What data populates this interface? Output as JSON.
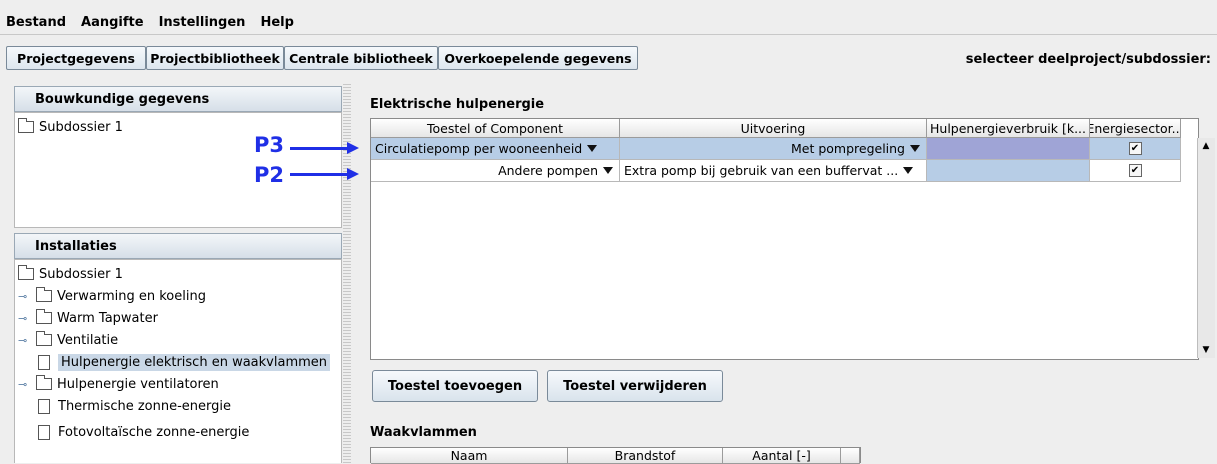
{
  "menu": [
    "Bestand",
    "Aangifte",
    "Instellingen",
    "Help"
  ],
  "tabs": [
    "Projectgegevens",
    "Projectbibliotheek",
    "Centrale bibliotheek",
    "Overkoepelende gegevens"
  ],
  "subproject_label": "selecteer deelproject/subdossier:",
  "left": {
    "bouw_title": "Bouwkundige gegevens",
    "bouw_tree": [
      "Subdossier 1"
    ],
    "inst_title": "Installaties",
    "inst_tree": {
      "root": "Subdossier 1",
      "items": [
        "Verwarming en koeling",
        "Warm Tapwater",
        "Ventilatie",
        "Hulpenergie elektrisch en waakvlammen",
        "Hulpenergie ventilatoren",
        "Thermische zonne-energie",
        "Fotovoltaïsche zonne-energie"
      ]
    }
  },
  "annotations": {
    "p3": "P3",
    "p2": "P2"
  },
  "section1": {
    "title": "Elektrische hulpenergie",
    "columns": [
      "Toestel of Component",
      "Uitvoering",
      "Hulpenergieverbruik [k...",
      "Energiesector..."
    ],
    "rows": [
      {
        "component": "Circulatiepomp per wooneenheid",
        "uitvoering": "Met pompregeling",
        "verbruik": "",
        "energiesector": true
      },
      {
        "component": "Andere pompen",
        "uitvoering": "Extra pomp bij gebruik van een buffervat ...",
        "verbruik": "",
        "energiesector": true
      }
    ]
  },
  "buttons": {
    "add": "Toestel toevoegen",
    "remove": "Toestel verwijderen"
  },
  "section2": {
    "title": "Waakvlammen",
    "columns": [
      "Naam",
      "Brandstof",
      "Aantal [-]"
    ]
  },
  "colors": {
    "selected_row": "#b7cde6",
    "highlight_cell": "#9fa4d6",
    "annotation": "#1f2fe6"
  }
}
